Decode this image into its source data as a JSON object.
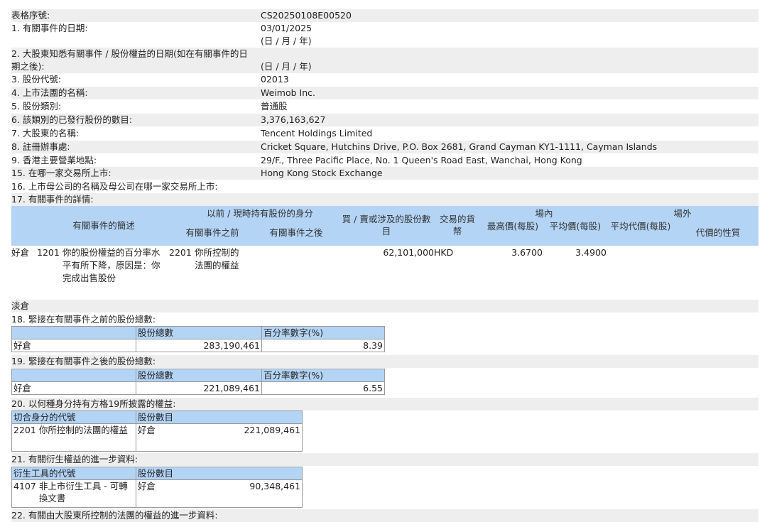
{
  "form": {
    "serial_label": "表格序號:",
    "serial_value": "CS20250108E00520",
    "f1_label": "1. 有關事件的日期:",
    "f1_value": "03/01/2025",
    "f1_fmt": "(日 / 月 / 年)",
    "f2_label": "2. 大股東知悉有關事件 / 股份權益的日期(如在有關事件的日期之後):",
    "f2_fmt": "(日 / 月 / 年)",
    "f3_label": "3. 股份代號:",
    "f3_value": "02013",
    "f4_label": "4. 上市法團的名稱:",
    "f4_value": "Weimob Inc.",
    "f5_label": "5. 股份類別:",
    "f5_value": "普通股",
    "f6_label": "6. 該類別的已發行股份的數目:",
    "f6_value": "3,376,163,627",
    "f7_label": "7. 大股東的名稱:",
    "f7_value": "Tencent Holdings Limited",
    "f8_label": "8. 註冊辦事處:",
    "f8_value": "Cricket Square, Hutchins Drive, P.O. Box 2681, Grand Cayman KY1-1111, Cayman Islands",
    "f9_label": "9. 香港主要營業地點:",
    "f9_value": "29/F., Three Pacific Place, No. 1 Queen's Road East, Wanchai, Hong Kong",
    "f15_label": "15. 在哪一家交易所上市:",
    "f15_value": "Hong Kong Stock Exchange",
    "f16_label": "16. 上市母公司的名稱及母公司在哪一家交易所上市:",
    "f17_label": "17. 有關事件的詳情:"
  },
  "details": {
    "h_desc": "有關事件的簡述",
    "h_capacity": "以前 / 現時持有股份的身分",
    "h_before": "有關事件之前",
    "h_after": "有關事件之後",
    "h_shares": "買 / 賣或涉及的股份數目",
    "h_currency": "交易的貨幣",
    "h_onex": "場內",
    "h_highest": "最高價(每股)",
    "h_average": "平均價(每股)",
    "h_offex": "場外",
    "h_avg_consideration": "平均代價(每股)",
    "h_nature": "代價的性質",
    "position": "好倉",
    "event_code": "1201",
    "event_desc": "你的股份權益的百分率水平有所下降，原因是：你完成出售股份",
    "capacity_code": "2201",
    "capacity_desc": "你所控制的法團的權益",
    "shares": "62,101,000",
    "currency": "HKD",
    "highest": "3.6700",
    "average": "3.4900",
    "short_label": "淡倉"
  },
  "s18": {
    "title": "18. 緊接在有關事件之前的股份總數:",
    "col1": "股份總數",
    "col2": "百分率數字(%)",
    "row_label": "好倉",
    "total": "283,190,461",
    "pct": "8.39"
  },
  "s19": {
    "title": "19. 緊接在有關事件之後的股份總數:",
    "col1": "股份總數",
    "col2": "百分率數字(%)",
    "row_label": "好倉",
    "total": "221,089,461",
    "pct": "6.55"
  },
  "s20": {
    "title": "20. 以何種身分持有方格19所披露的權益:",
    "col1": "切合身分的代號",
    "col2": "股份數目",
    "code": "2201",
    "desc": "你所控制的法團的權益",
    "position": "好倉",
    "shares": "221,089,461"
  },
  "s21": {
    "title": "21. 有關衍生權益的進一步資料:",
    "col1": "衍生工具的代號",
    "col2": "股份數目",
    "code": "4107",
    "desc": "非上市衍生工具 - 可轉換文書",
    "position": "好倉",
    "shares": "90,348,461"
  },
  "s22": {
    "title": "22. 有關由大股東所控制的法團的權益的進一步資料:"
  }
}
